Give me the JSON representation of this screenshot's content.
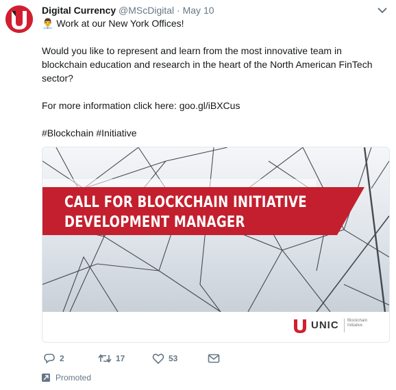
{
  "tweet": {
    "author_name": "Digital Currency",
    "handle": "@MScDigital",
    "separator": "·",
    "date": "May 10",
    "emoji": "👨‍💼",
    "lines": [
      "Work at our New York Offices!",
      "Would you like to represent and learn from the most innovative team in",
      "blockchain education and research in the heart of the North American FinTech",
      "sector?",
      "For more information click here: goo.gl/iBXCus",
      "#Blockchain #Initiative"
    ]
  },
  "card": {
    "banner_line1": "CALL FOR BLOCKCHAIN INITIATIVE",
    "banner_line2": "DEVELOPMENT MANAGER",
    "logo_text": "UNIC",
    "logo_sub1": "Blockchain",
    "logo_sub2": "Initiative"
  },
  "actions": {
    "replies": "2",
    "retweets": "17",
    "likes": "53"
  },
  "promoted_label": "Promoted",
  "colors": {
    "brand_red": "#d21f30",
    "text_gray": "#657786"
  },
  "icons": [
    "avatar-logo",
    "chevron-down-icon",
    "reply-icon",
    "retweet-icon",
    "like-icon",
    "message-icon",
    "promoted-icon"
  ]
}
